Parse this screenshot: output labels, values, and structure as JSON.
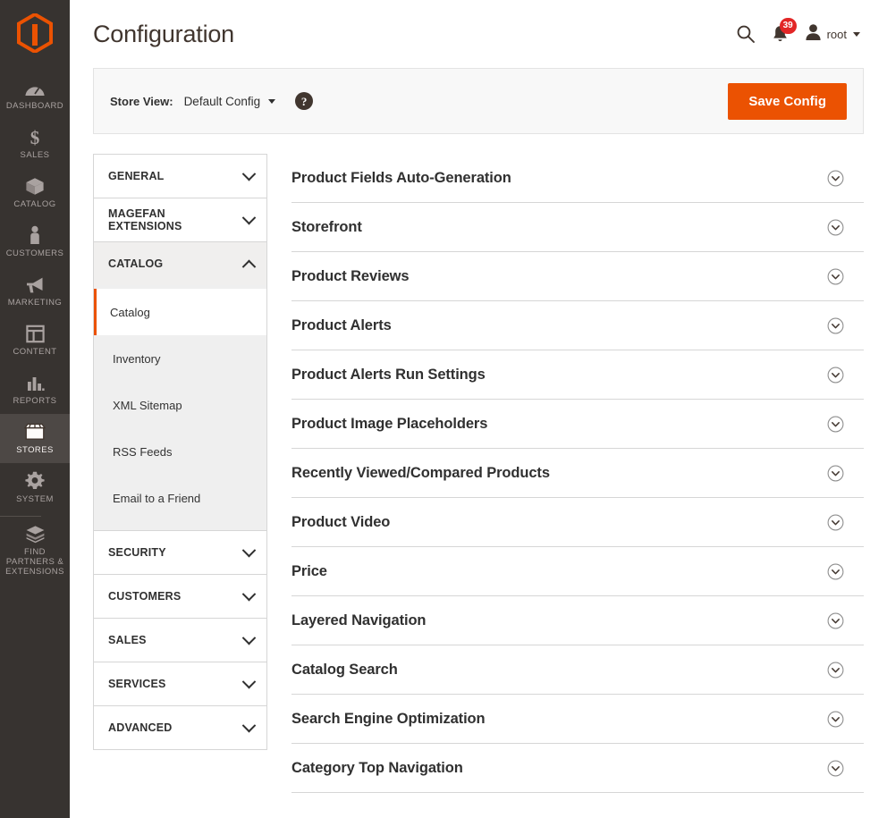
{
  "sidebar": {
    "logo_name": "magento-logo-icon",
    "items": [
      {
        "label": "DASHBOARD",
        "icon": "dashboard-gauge-icon",
        "active": false
      },
      {
        "label": "SALES",
        "icon": "dollar-sign-icon",
        "active": false
      },
      {
        "label": "CATALOG",
        "icon": "box-icon",
        "active": false
      },
      {
        "label": "CUSTOMERS",
        "icon": "person-icon",
        "active": false
      },
      {
        "label": "MARKETING",
        "icon": "megaphone-icon",
        "active": false
      },
      {
        "label": "CONTENT",
        "icon": "layout-panel-icon",
        "active": false
      },
      {
        "label": "REPORTS",
        "icon": "bar-chart-icon",
        "active": false
      },
      {
        "label": "STORES",
        "icon": "storefront-awning-icon",
        "active": true
      },
      {
        "label": "SYSTEM",
        "icon": "gear-icon",
        "active": false
      },
      {
        "label": "FIND PARTNERS\n& EXTENSIONS",
        "icon": "open-box-icon",
        "active": false
      }
    ]
  },
  "header": {
    "title": "Configuration",
    "search_icon": "search-icon",
    "notifications_icon": "bell-icon",
    "notifications_count": "39",
    "avatar_icon": "user-avatar-icon",
    "user_name": "root"
  },
  "storeview": {
    "label": "Store View:",
    "value": "Default Config",
    "help_icon": "question-mark-icon",
    "help_glyph": "?",
    "save_label": "Save Config"
  },
  "confignav": {
    "sections": [
      {
        "title": "GENERAL",
        "open": false,
        "items": []
      },
      {
        "title": "MAGEFAN EXTENSIONS",
        "open": false,
        "items": []
      },
      {
        "title": "CATALOG",
        "open": true,
        "items": [
          {
            "label": "Catalog",
            "active": true
          },
          {
            "label": "Inventory",
            "active": false
          },
          {
            "label": "XML Sitemap",
            "active": false
          },
          {
            "label": "RSS Feeds",
            "active": false
          },
          {
            "label": "Email to a Friend",
            "active": false
          }
        ]
      },
      {
        "title": "SECURITY",
        "open": false,
        "items": []
      },
      {
        "title": "CUSTOMERS",
        "open": false,
        "items": []
      },
      {
        "title": "SALES",
        "open": false,
        "items": []
      },
      {
        "title": "SERVICES",
        "open": false,
        "items": []
      },
      {
        "title": "ADVANCED",
        "open": false,
        "items": []
      }
    ]
  },
  "config_sections": [
    {
      "title": "Product Fields Auto-Generation"
    },
    {
      "title": "Storefront"
    },
    {
      "title": "Product Reviews"
    },
    {
      "title": "Product Alerts"
    },
    {
      "title": "Product Alerts Run Settings"
    },
    {
      "title": "Product Image Placeholders"
    },
    {
      "title": "Recently Viewed/Compared Products"
    },
    {
      "title": "Product Video"
    },
    {
      "title": "Price"
    },
    {
      "title": "Layered Navigation"
    },
    {
      "title": "Catalog Search"
    },
    {
      "title": "Search Engine Optimization"
    },
    {
      "title": "Category Top Navigation"
    }
  ],
  "colors": {
    "brand_orange": "#eb5202",
    "sidebar_bg": "#373330",
    "sidebar_active_bg": "#4d4845",
    "badge_red": "#e22626",
    "text_dark": "#303030",
    "panel_gray": "#f8f8f8"
  }
}
